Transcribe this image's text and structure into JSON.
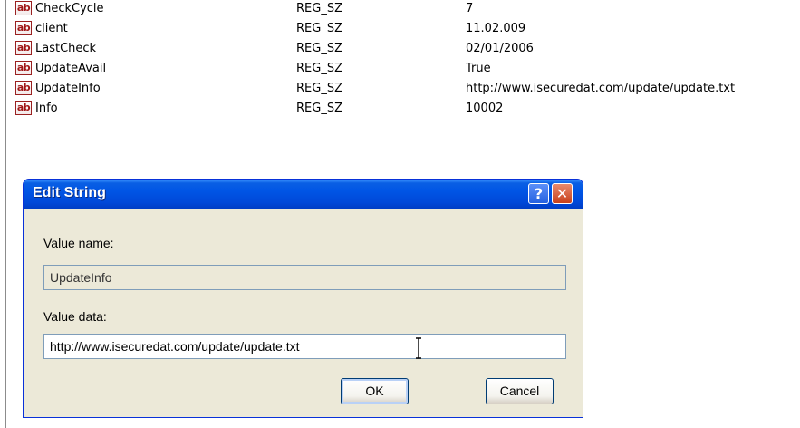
{
  "registry": {
    "rows": [
      {
        "icon": "ab",
        "name": "CheckCycle",
        "type": "REG_SZ",
        "data": "7"
      },
      {
        "icon": "ab",
        "name": "client",
        "type": "REG_SZ",
        "data": "11.02.009"
      },
      {
        "icon": "ab",
        "name": "LastCheck",
        "type": "REG_SZ",
        "data": "02/01/2006"
      },
      {
        "icon": "ab",
        "name": "UpdateAvail",
        "type": "REG_SZ",
        "data": "True"
      },
      {
        "icon": "ab",
        "name": "UpdateInfo",
        "type": "REG_SZ",
        "data": "http://www.isecuredat.com/update/update.txt"
      },
      {
        "icon": "ab",
        "name": "Info",
        "type": "REG_SZ",
        "data": "10002"
      }
    ]
  },
  "dialog": {
    "title": "Edit String",
    "help_glyph": "?",
    "close_glyph": "✕",
    "value_name_label": "Value name:",
    "value_name": "UpdateInfo",
    "value_data_label": "Value data:",
    "value_data": "http://www.isecuredat.com/update/update.txt",
    "ok_label": "OK",
    "cancel_label": "Cancel"
  },
  "colors": {
    "title_bar": "#0055e5",
    "dialog_bg": "#ece9d8",
    "icon_red": "#a01515"
  },
  "icons": {
    "string_value": "reg-string-icon",
    "help": "help-icon",
    "close": "close-icon",
    "cursor": "text-cursor-icon"
  }
}
